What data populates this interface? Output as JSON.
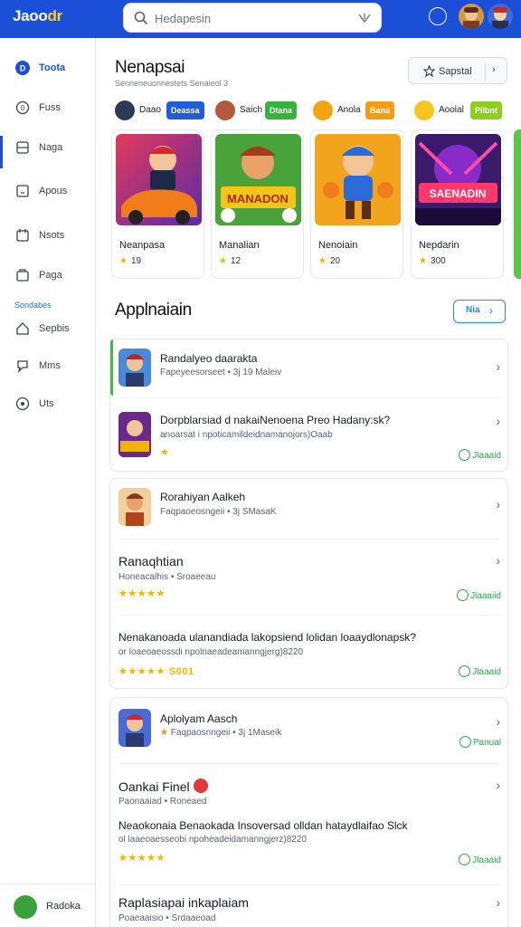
{
  "app": {
    "logo_text": "Jaoo",
    "logo_accent": "dr"
  },
  "search": {
    "placeholder": "Hedapesin"
  },
  "sidebar": {
    "items": [
      {
        "label": "Toota",
        "icon": "home-icon"
      },
      {
        "label": "Fuss",
        "icon": "circle-icon"
      },
      {
        "label": "Naga",
        "icon": "grid-icon"
      },
      {
        "label": "Apous",
        "icon": "square-icon"
      },
      {
        "label": "Nsots",
        "icon": "calendar-icon"
      },
      {
        "label": "Paga",
        "icon": "box-icon"
      }
    ],
    "section_label": "Sondabes",
    "section_items": [
      {
        "label": "Sepbis",
        "icon": "house-icon"
      },
      {
        "label": "Mms",
        "icon": "chat-icon"
      },
      {
        "label": "Uts",
        "icon": "disc-icon"
      }
    ],
    "footer_label": "Radoka"
  },
  "header": {
    "title": "Nenapsai",
    "subtitle": "Senneneuonnestets Senaieol 3",
    "sort_label": "Sapstal",
    "sort_chevron": "›"
  },
  "chips": [
    {
      "label": "Daao",
      "badge": "Deassa",
      "badge_color": "#1c5fd8",
      "dot_color": "#2d3a55"
    },
    {
      "label": "Saich",
      "badge": "Dtana",
      "badge_color": "#36b33a",
      "dot_color": "#b5593c"
    },
    {
      "label": "Anola",
      "badge": "Bana",
      "badge_color": "#f59d12",
      "dot_color": "#f2a510"
    },
    {
      "label": "Aoolal",
      "badge": "Pilbnt",
      "badge_color": "#8dcf1c",
      "dot_color": "#ffc320"
    }
  ],
  "featured": [
    {
      "title": "Neanpasa",
      "stat": "19"
    },
    {
      "title": "Manalian",
      "stat": "12"
    },
    {
      "title": "Nenoiain",
      "stat": "20"
    },
    {
      "title": "Nepdarin",
      "stat": "300"
    }
  ],
  "featured_art_text": [
    "",
    "MANADON",
    "",
    "SAENADIN"
  ],
  "section": {
    "title": "Applnaiain",
    "button_label": "Nia",
    "button_chevron": "›"
  },
  "list_panel_1": [
    {
      "title": "Randalyeo daarakta",
      "meta": "Fapeyeesorseet • 3j 19 Maleiv"
    },
    {
      "title": "Dorpblarsiad d nakaiNenoena Preo Hadany:sk?",
      "meta": "anoarsat i npoticamildeidnamanojors)Oaab",
      "status": "Jlaaaid"
    }
  ],
  "list_panel_2": [
    {
      "title": "Rorahiyan Aalkeh",
      "meta": "Faqpaoeosngeii • 3j SMasaK"
    },
    {
      "title": "Ranaqhtian",
      "meta": "Honeacalhis • Sroaeeau",
      "status": "Jlaaaiid"
    },
    {
      "title": "Nenakanoada ulanandiada lakopsiend lolidan loaaydlonapsk?",
      "meta": "or loaeoaeossdi npolnaeadeamanngjerg)8220",
      "stars_label": "S001",
      "status": "Jlaaaid"
    }
  ],
  "list_panel_3": [
    {
      "title": "Aplolyam Aasch",
      "meta": "Faqpaosnngeii • 3j 1Maseik",
      "status": "Panual"
    },
    {
      "title": "Oankai Finel",
      "meta": "Paonaaiad • Roneaed"
    },
    {
      "title": "Neaokonaia Benaokada Insoversad olldan hataydlaifao Slck",
      "meta": "ol laaeoaesseobi npoheadeidamanngjerz)8220",
      "status": "Jlaaaid"
    },
    {
      "title": "Raplasiapai inkaplaiam",
      "meta": "Poaeaaisio • Srdaaeoad"
    }
  ]
}
